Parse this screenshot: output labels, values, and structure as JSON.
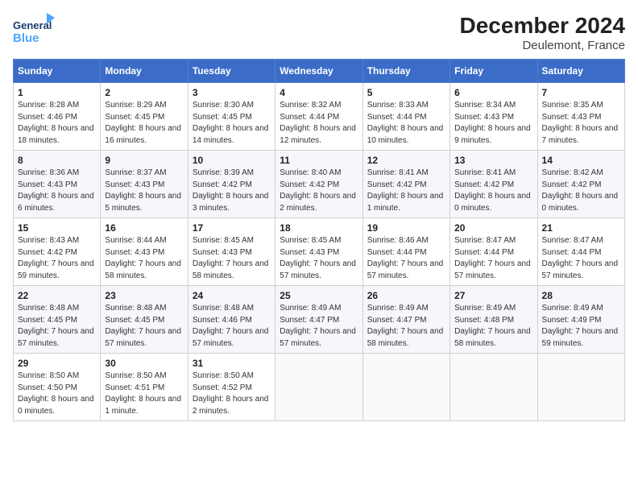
{
  "header": {
    "logo_general": "General",
    "logo_blue": "Blue",
    "title": "December 2024",
    "subtitle": "Deulemont, France"
  },
  "weekdays": [
    "Sunday",
    "Monday",
    "Tuesday",
    "Wednesday",
    "Thursday",
    "Friday",
    "Saturday"
  ],
  "weeks": [
    [
      {
        "day": "1",
        "sunrise": "8:28 AM",
        "sunset": "4:46 PM",
        "daylight": "8 hours and 18 minutes."
      },
      {
        "day": "2",
        "sunrise": "8:29 AM",
        "sunset": "4:45 PM",
        "daylight": "8 hours and 16 minutes."
      },
      {
        "day": "3",
        "sunrise": "8:30 AM",
        "sunset": "4:45 PM",
        "daylight": "8 hours and 14 minutes."
      },
      {
        "day": "4",
        "sunrise": "8:32 AM",
        "sunset": "4:44 PM",
        "daylight": "8 hours and 12 minutes."
      },
      {
        "day": "5",
        "sunrise": "8:33 AM",
        "sunset": "4:44 PM",
        "daylight": "8 hours and 10 minutes."
      },
      {
        "day": "6",
        "sunrise": "8:34 AM",
        "sunset": "4:43 PM",
        "daylight": "8 hours and 9 minutes."
      },
      {
        "day": "7",
        "sunrise": "8:35 AM",
        "sunset": "4:43 PM",
        "daylight": "8 hours and 7 minutes."
      }
    ],
    [
      {
        "day": "8",
        "sunrise": "8:36 AM",
        "sunset": "4:43 PM",
        "daylight": "8 hours and 6 minutes."
      },
      {
        "day": "9",
        "sunrise": "8:37 AM",
        "sunset": "4:43 PM",
        "daylight": "8 hours and 5 minutes."
      },
      {
        "day": "10",
        "sunrise": "8:39 AM",
        "sunset": "4:42 PM",
        "daylight": "8 hours and 3 minutes."
      },
      {
        "day": "11",
        "sunrise": "8:40 AM",
        "sunset": "4:42 PM",
        "daylight": "8 hours and 2 minutes."
      },
      {
        "day": "12",
        "sunrise": "8:41 AM",
        "sunset": "4:42 PM",
        "daylight": "8 hours and 1 minute."
      },
      {
        "day": "13",
        "sunrise": "8:41 AM",
        "sunset": "4:42 PM",
        "daylight": "8 hours and 0 minutes."
      },
      {
        "day": "14",
        "sunrise": "8:42 AM",
        "sunset": "4:42 PM",
        "daylight": "8 hours and 0 minutes."
      }
    ],
    [
      {
        "day": "15",
        "sunrise": "8:43 AM",
        "sunset": "4:42 PM",
        "daylight": "7 hours and 59 minutes."
      },
      {
        "day": "16",
        "sunrise": "8:44 AM",
        "sunset": "4:43 PM",
        "daylight": "7 hours and 58 minutes."
      },
      {
        "day": "17",
        "sunrise": "8:45 AM",
        "sunset": "4:43 PM",
        "daylight": "7 hours and 58 minutes."
      },
      {
        "day": "18",
        "sunrise": "8:45 AM",
        "sunset": "4:43 PM",
        "daylight": "7 hours and 57 minutes."
      },
      {
        "day": "19",
        "sunrise": "8:46 AM",
        "sunset": "4:44 PM",
        "daylight": "7 hours and 57 minutes."
      },
      {
        "day": "20",
        "sunrise": "8:47 AM",
        "sunset": "4:44 PM",
        "daylight": "7 hours and 57 minutes."
      },
      {
        "day": "21",
        "sunrise": "8:47 AM",
        "sunset": "4:44 PM",
        "daylight": "7 hours and 57 minutes."
      }
    ],
    [
      {
        "day": "22",
        "sunrise": "8:48 AM",
        "sunset": "4:45 PM",
        "daylight": "7 hours and 57 minutes."
      },
      {
        "day": "23",
        "sunrise": "8:48 AM",
        "sunset": "4:45 PM",
        "daylight": "7 hours and 57 minutes."
      },
      {
        "day": "24",
        "sunrise": "8:48 AM",
        "sunset": "4:46 PM",
        "daylight": "7 hours and 57 minutes."
      },
      {
        "day": "25",
        "sunrise": "8:49 AM",
        "sunset": "4:47 PM",
        "daylight": "7 hours and 57 minutes."
      },
      {
        "day": "26",
        "sunrise": "8:49 AM",
        "sunset": "4:47 PM",
        "daylight": "7 hours and 58 minutes."
      },
      {
        "day": "27",
        "sunrise": "8:49 AM",
        "sunset": "4:48 PM",
        "daylight": "7 hours and 58 minutes."
      },
      {
        "day": "28",
        "sunrise": "8:49 AM",
        "sunset": "4:49 PM",
        "daylight": "7 hours and 59 minutes."
      }
    ],
    [
      {
        "day": "29",
        "sunrise": "8:50 AM",
        "sunset": "4:50 PM",
        "daylight": "8 hours and 0 minutes."
      },
      {
        "day": "30",
        "sunrise": "8:50 AM",
        "sunset": "4:51 PM",
        "daylight": "8 hours and 1 minute."
      },
      {
        "day": "31",
        "sunrise": "8:50 AM",
        "sunset": "4:52 PM",
        "daylight": "8 hours and 2 minutes."
      },
      null,
      null,
      null,
      null
    ]
  ],
  "labels": {
    "sunrise": "Sunrise:",
    "sunset": "Sunset:",
    "daylight": "Daylight:"
  }
}
